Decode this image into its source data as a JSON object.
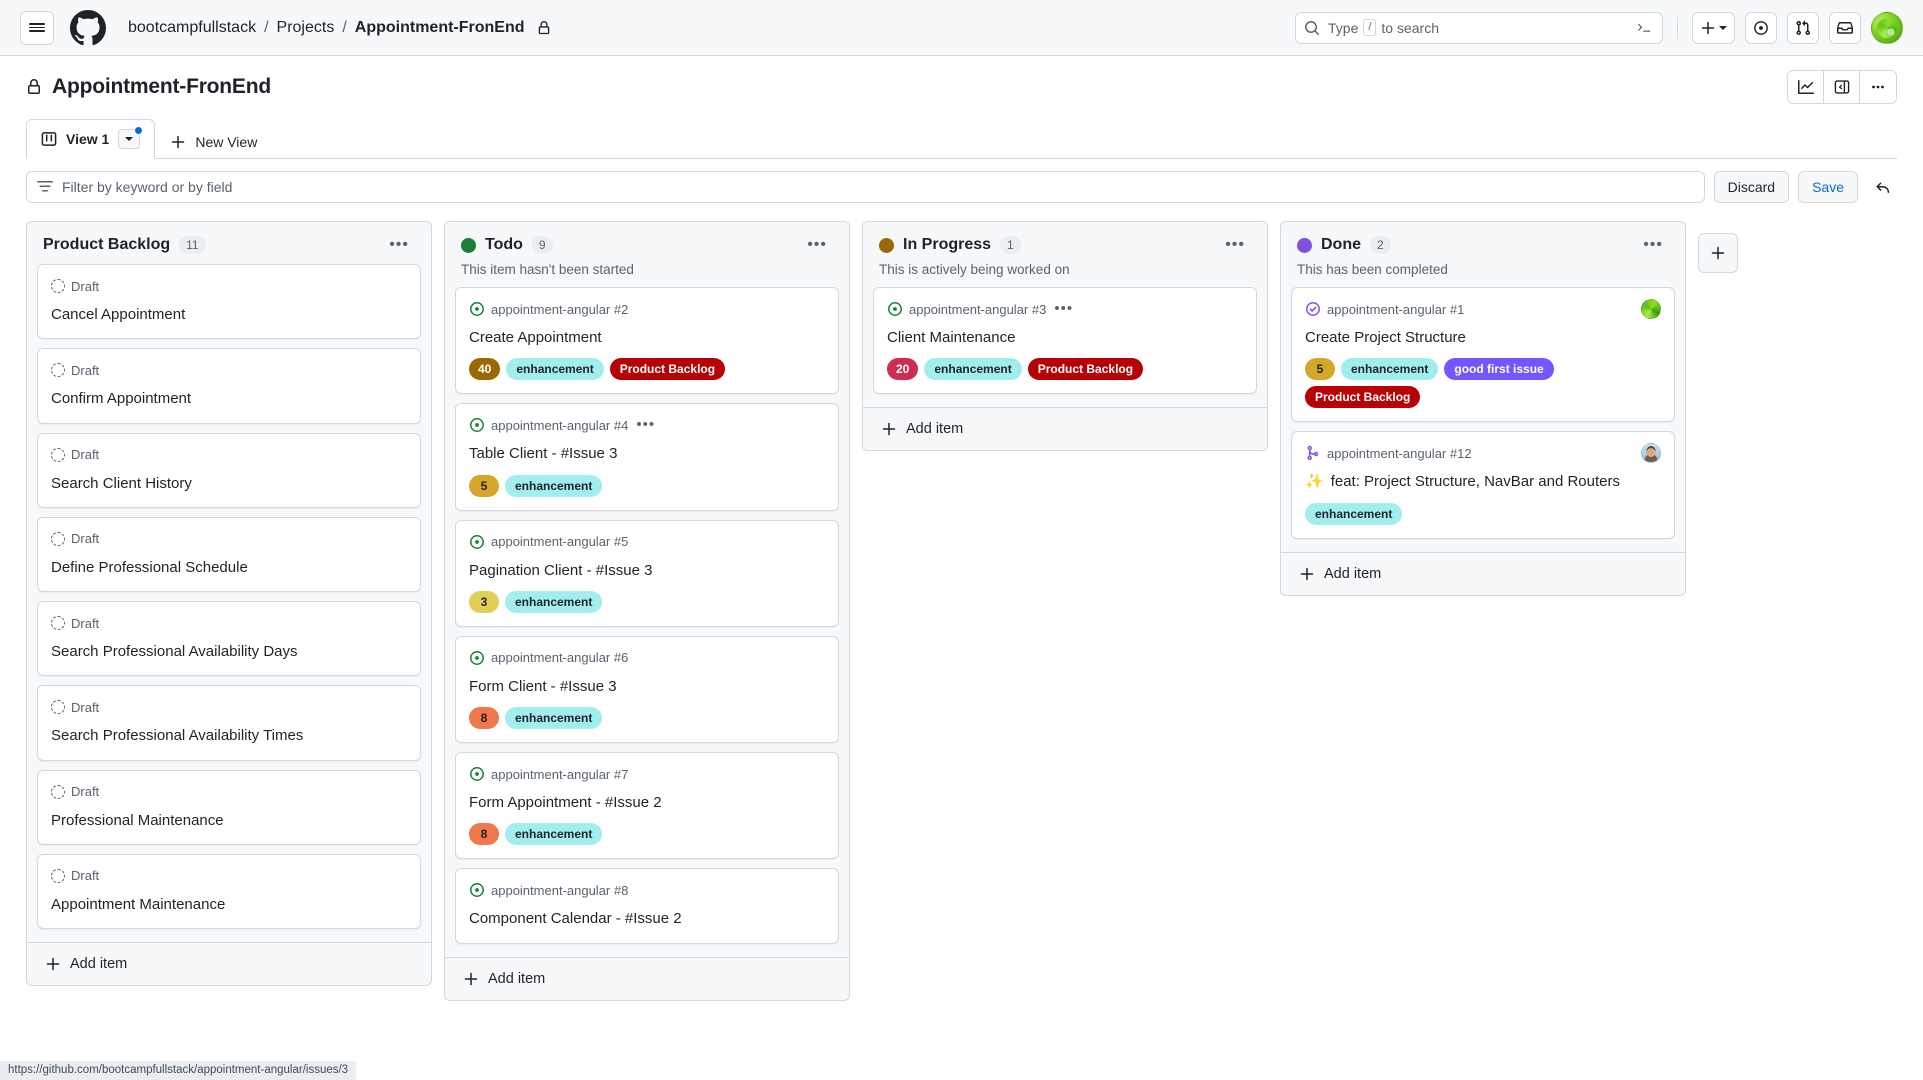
{
  "appbar": {
    "menu_icon": "hamburger-icon",
    "logo_icon": "github-mark-icon",
    "breadcrumb": {
      "owner": "bootcampfullstack",
      "sep": "/",
      "section": "Projects",
      "current": "Appointment-FronEnd",
      "lock_icon": "lock-icon"
    },
    "search": {
      "icon": "search-icon",
      "placeholder_prefix": "Type",
      "slash_key": "/",
      "placeholder_suffix": "to search",
      "command_icon": "terminal-icon"
    },
    "actions": [
      {
        "name": "create-new-button",
        "icon": "plus-icon",
        "caret": true
      },
      {
        "name": "issues-button",
        "icon": "issue-opened-icon"
      },
      {
        "name": "pull-requests-button",
        "icon": "git-pull-request-icon"
      },
      {
        "name": "inbox-button",
        "icon": "inbox-icon"
      }
    ],
    "avatar_name": "user-avatar"
  },
  "project": {
    "lock_icon": "lock-icon",
    "title": "Appointment-FronEnd",
    "actions": [
      {
        "name": "insights-button",
        "icon": "graph-icon"
      },
      {
        "name": "toggle-sidebar-button",
        "icon": "sidebar-expand-icon"
      },
      {
        "name": "project-menu-button",
        "icon": "kebab-horizontal-icon"
      }
    ],
    "tabs": [
      {
        "label": "View 1",
        "icon": "board-view-icon",
        "active": true,
        "has_unsaved_dot": true
      },
      {
        "label": "New View",
        "icon": "plus-icon",
        "active": false
      }
    ]
  },
  "filterbar": {
    "icon": "filter-icon",
    "placeholder": "Filter by keyword or by field",
    "value": "",
    "discard_label": "Discard",
    "save_label": "Save",
    "undo_icon": "undo-icon"
  },
  "board": {
    "add_column_icon": "plus-icon",
    "add_item_label": "Add item",
    "columns": [
      {
        "name": "Product Backlog",
        "count": "11",
        "dot_color": null,
        "description": "",
        "menu_icon": "kebab-horizontal-icon",
        "cards": [
          {
            "type": "draft",
            "meta": "Draft",
            "title": "Cancel Appointment",
            "labels": []
          },
          {
            "type": "draft",
            "meta": "Draft",
            "title": "Confirm Appointment",
            "labels": []
          },
          {
            "type": "draft",
            "meta": "Draft",
            "title": "Search Client History",
            "labels": []
          },
          {
            "type": "draft",
            "meta": "Draft",
            "title": "Define Professional Schedule",
            "labels": []
          },
          {
            "type": "draft",
            "meta": "Draft",
            "title": "Search Professional Availability Days",
            "labels": []
          },
          {
            "type": "draft",
            "meta": "Draft",
            "title": "Search Professional Availability Times",
            "labels": []
          },
          {
            "type": "draft",
            "meta": "Draft",
            "title": "Professional Maintenance",
            "labels": []
          },
          {
            "type": "draft",
            "meta": "Draft",
            "title": "Appointment Maintenance",
            "labels": []
          }
        ]
      },
      {
        "name": "Todo",
        "count": "9",
        "dot_color": "#1a7f37",
        "description": "This item hasn't been started",
        "menu_icon": "kebab-horizontal-icon",
        "cards": [
          {
            "type": "issue",
            "meta": "appointment-angular #2",
            "title": "Create Appointment",
            "labels": [
              {
                "text": "40",
                "bg": "#9a6700",
                "fg": "#ffffff",
                "kind": "number"
              },
              {
                "text": "enhancement",
                "bg": "#a2eeef",
                "fg": "#1f2328",
                "kind": "label"
              },
              {
                "text": "Product Backlog",
                "bg": "#b60205",
                "fg": "#ffffff",
                "kind": "label"
              }
            ]
          },
          {
            "type": "issue",
            "meta": "appointment-angular #4",
            "title": "Table Client - #Issue 3",
            "show_dots": true,
            "show_cursor": true,
            "labels": [
              {
                "text": "5",
                "bg": "#d4a72c",
                "fg": "#1f2328",
                "kind": "number"
              },
              {
                "text": "enhancement",
                "bg": "#a2eeef",
                "fg": "#1f2328",
                "kind": "label"
              }
            ]
          },
          {
            "type": "issue",
            "meta": "appointment-angular #5",
            "title": "Pagination Client - #Issue 3",
            "labels": [
              {
                "text": "3",
                "bg": "#e3ce55",
                "fg": "#1f2328",
                "kind": "number"
              },
              {
                "text": "enhancement",
                "bg": "#a2eeef",
                "fg": "#1f2328",
                "kind": "label"
              }
            ]
          },
          {
            "type": "issue",
            "meta": "appointment-angular #6",
            "title": "Form Client - #Issue 3",
            "labels": [
              {
                "text": "8",
                "bg": "#f1784b",
                "fg": "#1f2328",
                "kind": "number"
              },
              {
                "text": "enhancement",
                "bg": "#a2eeef",
                "fg": "#1f2328",
                "kind": "label"
              }
            ]
          },
          {
            "type": "issue",
            "meta": "appointment-angular #7",
            "title": "Form Appointment - #Issue 2",
            "labels": [
              {
                "text": "8",
                "bg": "#f1784b",
                "fg": "#1f2328",
                "kind": "number"
              },
              {
                "text": "enhancement",
                "bg": "#a2eeef",
                "fg": "#1f2328",
                "kind": "label"
              }
            ]
          },
          {
            "type": "issue",
            "meta": "appointment-angular #8",
            "title": "Component Calendar - #Issue 2",
            "labels": []
          }
        ]
      },
      {
        "name": "In Progress",
        "count": "1",
        "dot_color": "#9a6700",
        "description": "This is actively being worked on",
        "menu_icon": "kebab-horizontal-icon",
        "cards": [
          {
            "type": "issue",
            "meta": "appointment-angular #3",
            "title": "Client Maintenance",
            "show_dots": true,
            "labels": [
              {
                "text": "20",
                "bg": "#cf2e52",
                "fg": "#ffffff",
                "kind": "number"
              },
              {
                "text": "enhancement",
                "bg": "#a2eeef",
                "fg": "#1f2328",
                "kind": "label"
              },
              {
                "text": "Product Backlog",
                "bg": "#b60205",
                "fg": "#ffffff",
                "kind": "label"
              }
            ]
          }
        ]
      },
      {
        "name": "Done",
        "count": "2",
        "dot_color": "#8250df",
        "description": "This has been completed",
        "menu_icon": "kebab-horizontal-icon",
        "cards": [
          {
            "type": "closed-issue",
            "meta": "appointment-angular #1",
            "title": "Create Project Structure",
            "avatar": "green",
            "labels": [
              {
                "text": "5",
                "bg": "#d4a72c",
                "fg": "#1f2328",
                "kind": "number"
              },
              {
                "text": "enhancement",
                "bg": "#a2eeef",
                "fg": "#1f2328",
                "kind": "label"
              },
              {
                "text": "good first issue",
                "bg": "#7057ff",
                "fg": "#ffffff",
                "kind": "label"
              },
              {
                "text": "Product Backlog",
                "bg": "#b60205",
                "fg": "#ffffff",
                "kind": "label"
              }
            ]
          },
          {
            "type": "merged-pr",
            "meta": "appointment-angular #12",
            "emoji": "✨",
            "title": "feat: Project Structure, NavBar and Routers",
            "avatar": "photo",
            "labels": [
              {
                "text": "enhancement",
                "bg": "#a2eeef",
                "fg": "#1f2328",
                "kind": "label"
              }
            ]
          }
        ]
      }
    ]
  },
  "statusbar": {
    "url": "https://github.com/bootcampfullstack/appointment-angular/issues/3"
  }
}
